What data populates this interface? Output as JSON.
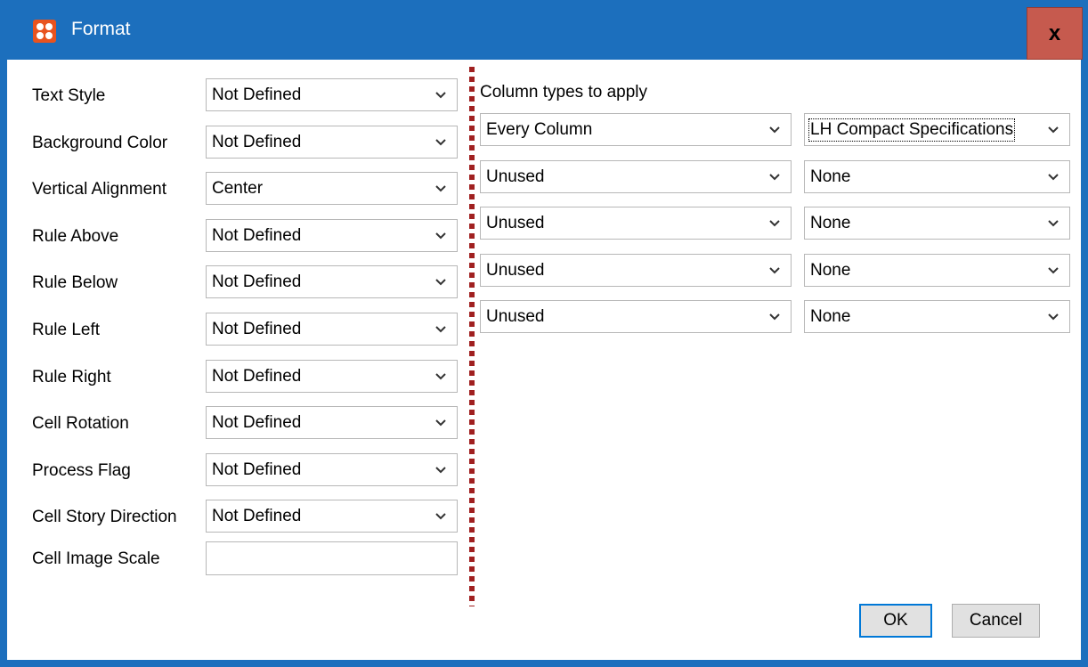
{
  "window": {
    "title": "Format",
    "close_symbol": "x"
  },
  "properties": [
    {
      "label": "Text Style",
      "value": "Not Defined"
    },
    {
      "label": "Background Color",
      "value": "Not Defined"
    },
    {
      "label": "Vertical Alignment",
      "value": "Center"
    },
    {
      "label": "Rule Above",
      "value": "Not Defined"
    },
    {
      "label": "Rule Below",
      "value": "Not Defined"
    },
    {
      "label": "Rule Left",
      "value": "Not Defined"
    },
    {
      "label": "Rule Right",
      "value": "Not Defined"
    },
    {
      "label": "Cell Rotation",
      "value": "Not Defined"
    },
    {
      "label": "Process Flag",
      "value": "Not Defined"
    },
    {
      "label": "Cell Story Direction",
      "value": "Not Defined"
    }
  ],
  "image_scale": {
    "label": "Cell Image Scale",
    "value": ""
  },
  "column_types": {
    "header": "Column types to apply",
    "rows": [
      {
        "type": "Every Column",
        "spec": "LH Compact Specifications"
      },
      {
        "type": "Unused",
        "spec": "None"
      },
      {
        "type": "Unused",
        "spec": "None"
      },
      {
        "type": "Unused",
        "spec": "None"
      },
      {
        "type": "Unused",
        "spec": "None"
      }
    ]
  },
  "buttons": {
    "ok": "OK",
    "cancel": "Cancel"
  },
  "colors": {
    "titlebar": "#1c6fbd",
    "close": "#c65a4e",
    "divider": "#a02020",
    "icon": "#e8531f"
  }
}
